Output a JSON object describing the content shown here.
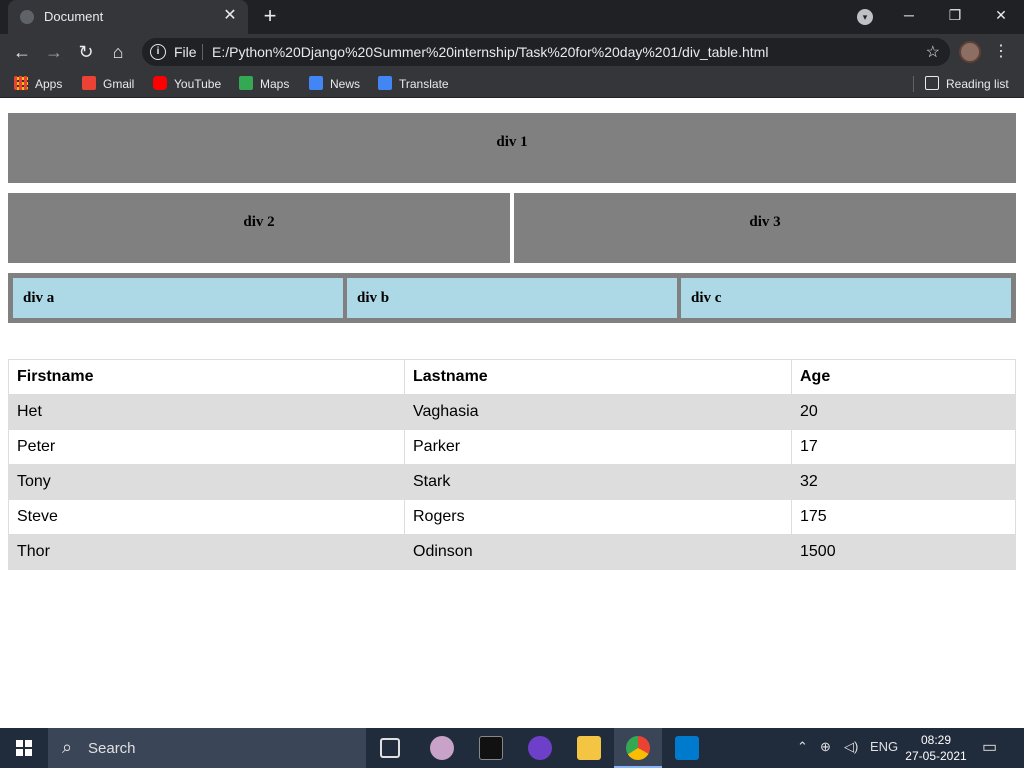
{
  "browser": {
    "tab": {
      "title": "Document",
      "close": "✕"
    },
    "new_tab": "+",
    "window_controls": {
      "minimize": "─",
      "restore": "❐",
      "close": "✕"
    },
    "address_bar": {
      "scheme": "File",
      "url": "E:/Python%20Django%20Summer%20internship/Task%20for%20day%201/div_table.html"
    },
    "bookmarks": [
      {
        "label": "Apps",
        "icon": "apps-grid-icon",
        "color": "#4285f4"
      },
      {
        "label": "Gmail",
        "icon": "gmail-icon",
        "color": "#ea4335"
      },
      {
        "label": "YouTube",
        "icon": "youtube-icon",
        "color": "#ff0000"
      },
      {
        "label": "Maps",
        "icon": "maps-icon",
        "color": "#34a853"
      },
      {
        "label": "News",
        "icon": "news-icon",
        "color": "#4285f4"
      },
      {
        "label": "Translate",
        "icon": "translate-icon",
        "color": "#4285f4"
      }
    ],
    "reading_list": "Reading list"
  },
  "page": {
    "div1": "div 1",
    "div2": "div 2",
    "div3": "div 3",
    "inner": [
      "div a",
      "div b",
      "div c"
    ],
    "table": {
      "headers": [
        "Firstname",
        "Lastname",
        "Age"
      ],
      "rows": [
        [
          "Het",
          "Vaghasia",
          "20"
        ],
        [
          "Peter",
          "Parker",
          "17"
        ],
        [
          "Tony",
          "Stark",
          "32"
        ],
        [
          "Steve",
          "Rogers",
          "175"
        ],
        [
          "Thor",
          "Odinson",
          "1500"
        ]
      ]
    }
  },
  "taskbar": {
    "search_placeholder": "Search",
    "language": "ENG",
    "time": "08:29",
    "date": "27-05-2021"
  }
}
